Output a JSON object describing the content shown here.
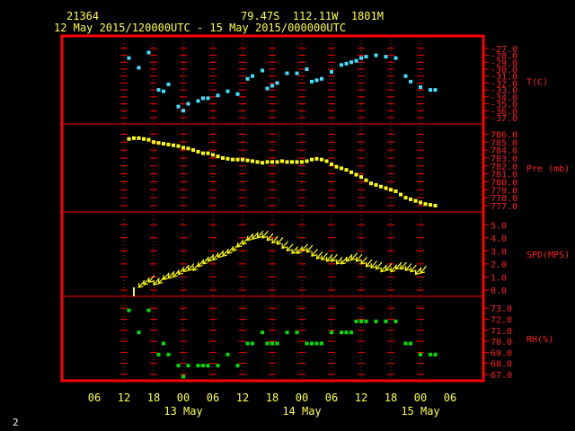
{
  "header": {
    "station": "21364",
    "location": "79.47S  112.11W  1801M",
    "period": "12 May 2015/120000UTC - 15 May 2015/000000UTC"
  },
  "page_number": "2",
  "chart_data": {
    "type": "scatter",
    "x_axis": {
      "unit": "hours from 12 May 2015 06 UTC",
      "range": [
        0,
        72
      ],
      "tick_labels": [
        "06",
        "12",
        "18",
        "00",
        "06",
        "12",
        "18",
        "00",
        "06",
        "12",
        "18",
        "00",
        "06"
      ],
      "date_labels": [
        {
          "text": "13 May",
          "at": 18
        },
        {
          "text": "14 May",
          "at": 42
        },
        {
          "text": "15 May",
          "at": 66
        }
      ]
    },
    "colors": {
      "frame": "#ff0000",
      "grid": "#ff0000",
      "text": "#ffff40",
      "temp": "#40e0ff",
      "pres": "#ffff00",
      "wind": "#ffff00",
      "rh": "#00e000",
      "axis_labels": "#ff2020"
    },
    "panels": [
      {
        "id": "temp",
        "label": "T(C)",
        "ylim": [
          -37,
          -26.5
        ],
        "tick_labels": [
          "-27.0",
          "-28.0",
          "-29.0",
          "-30.0",
          "-31.0",
          "-32.0",
          "-33.0",
          "-34.0",
          "-35.0",
          "-36.0",
          "-37.0"
        ],
        "points": [
          [
            7,
            -28.4
          ],
          [
            9,
            -29.8
          ],
          [
            11,
            -27.6
          ],
          [
            13,
            -33.0
          ],
          [
            14,
            -33.2
          ],
          [
            15,
            -32.2
          ],
          [
            17,
            -35.4
          ],
          [
            18,
            -36.0
          ],
          [
            19,
            -35.0
          ],
          [
            21,
            -34.6
          ],
          [
            22,
            -34.2
          ],
          [
            23,
            -34.2
          ],
          [
            25,
            -33.8
          ],
          [
            27,
            -33.2
          ],
          [
            29,
            -33.6
          ],
          [
            31,
            -31.4
          ],
          [
            32,
            -31.0
          ],
          [
            34,
            -30.2
          ],
          [
            35,
            -32.8
          ],
          [
            36,
            -32.4
          ],
          [
            37,
            -32.0
          ],
          [
            39,
            -30.6
          ],
          [
            41,
            -30.6
          ],
          [
            43,
            -30.0
          ],
          [
            44,
            -31.8
          ],
          [
            45,
            -31.6
          ],
          [
            46,
            -31.4
          ],
          [
            48,
            -30.4
          ],
          [
            50,
            -29.4
          ],
          [
            51,
            -29.2
          ],
          [
            52,
            -29.0
          ],
          [
            53,
            -28.8
          ],
          [
            54,
            -28.4
          ],
          [
            55,
            -28.2
          ],
          [
            57,
            -28.0
          ],
          [
            59,
            -28.2
          ],
          [
            61,
            -28.4
          ],
          [
            63,
            -31.0
          ],
          [
            64,
            -31.8
          ],
          [
            66,
            -32.6
          ],
          [
            68,
            -33.0
          ],
          [
            69,
            -33.0
          ]
        ]
      },
      {
        "id": "pres",
        "label": "Pre (mb)",
        "ylim": [
          777,
          786.5
        ],
        "tick_labels": [
          "786.0",
          "785.0",
          "784.0",
          "783.0",
          "782.0",
          "781.0",
          "780.0",
          "779.0",
          "778.0",
          "777.0"
        ],
        "points": [
          [
            7,
            785.4
          ],
          [
            8,
            785.5
          ],
          [
            9,
            785.5
          ],
          [
            10,
            785.4
          ],
          [
            11,
            785.3
          ],
          [
            12,
            785.0
          ],
          [
            13,
            784.9
          ],
          [
            14,
            784.8
          ],
          [
            15,
            784.7
          ],
          [
            16,
            784.6
          ],
          [
            17,
            784.5
          ],
          [
            18,
            784.3
          ],
          [
            19,
            784.2
          ],
          [
            20,
            784.0
          ],
          [
            21,
            783.8
          ],
          [
            22,
            783.6
          ],
          [
            23,
            783.6
          ],
          [
            24,
            783.4
          ],
          [
            25,
            783.2
          ],
          [
            26,
            783.0
          ],
          [
            27,
            782.9
          ],
          [
            28,
            782.8
          ],
          [
            29,
            782.8
          ],
          [
            30,
            782.8
          ],
          [
            31,
            782.7
          ],
          [
            32,
            782.6
          ],
          [
            33,
            782.5
          ],
          [
            34,
            782.4
          ],
          [
            35,
            782.5
          ],
          [
            36,
            782.5
          ],
          [
            37,
            782.5
          ],
          [
            38,
            782.6
          ],
          [
            39,
            782.5
          ],
          [
            40,
            782.5
          ],
          [
            41,
            782.5
          ],
          [
            42,
            782.5
          ],
          [
            43,
            782.6
          ],
          [
            44,
            782.8
          ],
          [
            45,
            782.9
          ],
          [
            46,
            782.8
          ],
          [
            47,
            782.6
          ],
          [
            48,
            782.2
          ],
          [
            49,
            781.9
          ],
          [
            50,
            781.7
          ],
          [
            51,
            781.5
          ],
          [
            52,
            781.2
          ],
          [
            53,
            780.9
          ],
          [
            54,
            780.6
          ],
          [
            55,
            780.2
          ],
          [
            56,
            779.8
          ],
          [
            57,
            779.6
          ],
          [
            58,
            779.4
          ],
          [
            59,
            779.2
          ],
          [
            60,
            779.0
          ],
          [
            61,
            778.8
          ],
          [
            62,
            778.4
          ],
          [
            63,
            778.0
          ],
          [
            64,
            777.8
          ],
          [
            65,
            777.6
          ],
          [
            66,
            777.4
          ],
          [
            67,
            777.2
          ],
          [
            68,
            777.1
          ],
          [
            69,
            777.0
          ]
        ]
      },
      {
        "id": "wind",
        "label": "SPD(MPS)",
        "ylim": [
          0,
          5.5
        ],
        "tick_labels": [
          "0.0",
          "1.0",
          "2.0",
          "3.0",
          "4.0",
          "5.0"
        ],
        "points": [
          [
            8,
            0.0
          ],
          [
            9,
            0.2
          ],
          [
            10,
            0.4
          ],
          [
            11,
            0.6
          ],
          [
            12,
            0.4
          ],
          [
            13,
            0.5
          ],
          [
            14,
            0.8
          ],
          [
            15,
            0.9
          ],
          [
            16,
            1.0
          ],
          [
            17,
            1.2
          ],
          [
            18,
            1.4
          ],
          [
            19,
            1.5
          ],
          [
            20,
            1.5
          ],
          [
            21,
            1.8
          ],
          [
            22,
            2.0
          ],
          [
            23,
            2.2
          ],
          [
            24,
            2.3
          ],
          [
            25,
            2.5
          ],
          [
            26,
            2.6
          ],
          [
            27,
            2.8
          ],
          [
            28,
            3.0
          ],
          [
            29,
            3.3
          ],
          [
            30,
            3.5
          ],
          [
            31,
            3.8
          ],
          [
            32,
            3.9
          ],
          [
            33,
            4.0
          ],
          [
            34,
            4.0
          ],
          [
            35,
            3.8
          ],
          [
            36,
            3.6
          ],
          [
            37,
            3.5
          ],
          [
            38,
            3.2
          ],
          [
            39,
            3.0
          ],
          [
            40,
            2.8
          ],
          [
            41,
            2.8
          ],
          [
            42,
            3.0
          ],
          [
            43,
            2.9
          ],
          [
            44,
            2.6
          ],
          [
            45,
            2.4
          ],
          [
            46,
            2.3
          ],
          [
            47,
            2.2
          ],
          [
            48,
            2.2
          ],
          [
            49,
            2.0
          ],
          [
            50,
            2.0
          ],
          [
            51,
            2.2
          ],
          [
            52,
            2.3
          ],
          [
            53,
            2.2
          ],
          [
            54,
            2.0
          ],
          [
            55,
            1.8
          ],
          [
            56,
            1.7
          ],
          [
            57,
            1.6
          ],
          [
            58,
            1.4
          ],
          [
            59,
            1.5
          ],
          [
            60,
            1.4
          ],
          [
            61,
            1.6
          ],
          [
            62,
            1.6
          ],
          [
            63,
            1.5
          ],
          [
            64,
            1.4
          ],
          [
            65,
            1.2
          ],
          [
            66,
            1.3
          ]
        ]
      },
      {
        "id": "rh",
        "label": "RH(%)",
        "ylim": [
          67,
          73.5
        ],
        "tick_labels": [
          "73.0",
          "72.0",
          "71.0",
          "70.0",
          "69.0",
          "68.0",
          "67.0"
        ],
        "points": [
          [
            7,
            72.8
          ],
          [
            9,
            70.8
          ],
          [
            11,
            72.8
          ],
          [
            13,
            68.8
          ],
          [
            14,
            69.8
          ],
          [
            15,
            68.8
          ],
          [
            17,
            67.8
          ],
          [
            18,
            66.8
          ],
          [
            19,
            67.8
          ],
          [
            21,
            67.8
          ],
          [
            22,
            67.8
          ],
          [
            23,
            67.8
          ],
          [
            25,
            67.8
          ],
          [
            27,
            68.8
          ],
          [
            29,
            67.8
          ],
          [
            31,
            69.8
          ],
          [
            32,
            69.8
          ],
          [
            34,
            70.8
          ],
          [
            35,
            69.8
          ],
          [
            36,
            69.8
          ],
          [
            37,
            69.8
          ],
          [
            39,
            70.8
          ],
          [
            41,
            70.8
          ],
          [
            43,
            69.8
          ],
          [
            44,
            69.8
          ],
          [
            45,
            69.8
          ],
          [
            46,
            69.8
          ],
          [
            48,
            70.8
          ],
          [
            50,
            70.8
          ],
          [
            51,
            70.8
          ],
          [
            52,
            70.8
          ],
          [
            53,
            71.8
          ],
          [
            54,
            71.8
          ],
          [
            55,
            71.8
          ],
          [
            57,
            71.8
          ],
          [
            59,
            71.8
          ],
          [
            61,
            71.8
          ],
          [
            63,
            69.8
          ],
          [
            64,
            69.8
          ],
          [
            66,
            68.8
          ],
          [
            68,
            68.8
          ],
          [
            69,
            68.8
          ]
        ]
      }
    ]
  }
}
